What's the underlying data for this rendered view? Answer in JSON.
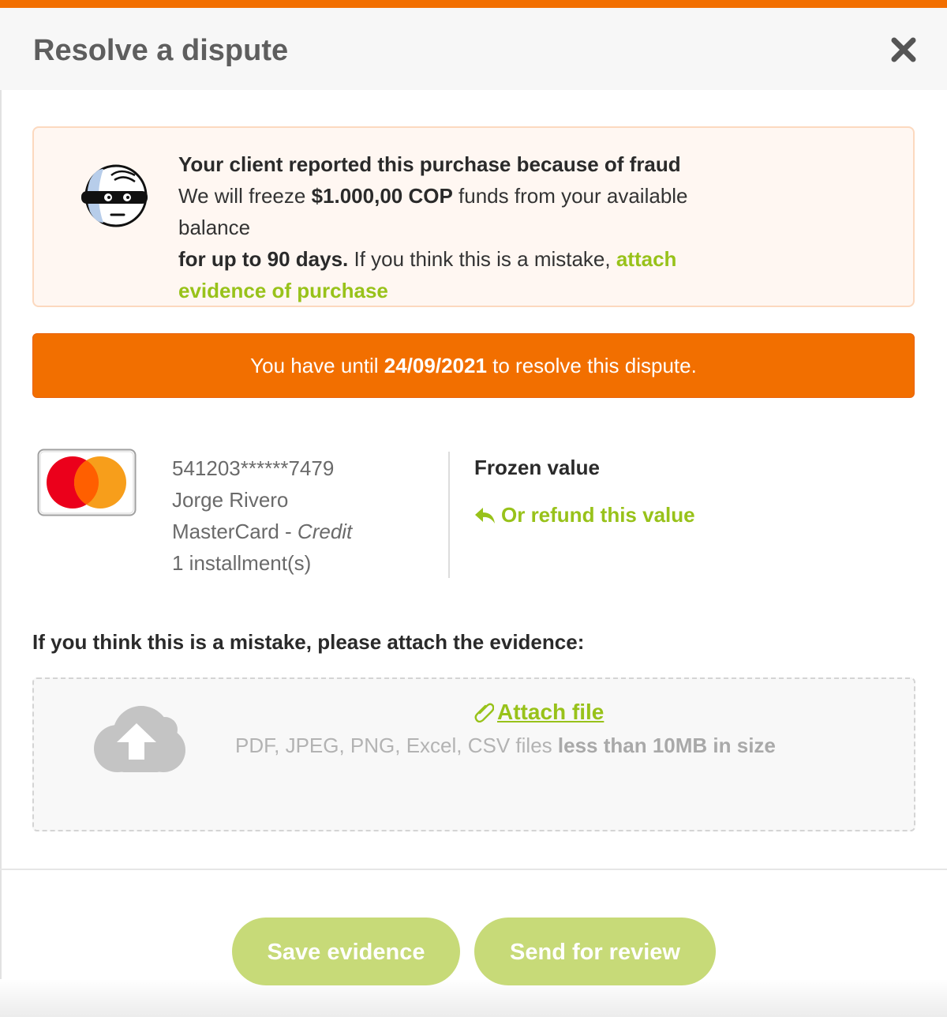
{
  "modal": {
    "title": "Resolve a dispute",
    "close_icon": "close-icon"
  },
  "alert": {
    "icon": "thief-icon",
    "heading": "Your client reported this purchase because of fraud",
    "line1_pre": "We will freeze ",
    "amount": "$1.000,00 COP",
    "line1_post": " funds from your available balance",
    "period": "for up to 90 days.",
    "line2_post": " If you think this is a mistake, ",
    "link": "attach evidence of purchase"
  },
  "deadline": {
    "pre": "You have until ",
    "date": "24/09/2021",
    "post": " to resolve this dispute."
  },
  "card": {
    "brand_icon": "mastercard-icon",
    "number": "541203******7479",
    "holder": "Jorge Rivero",
    "brand": "MasterCard - ",
    "type": "Credit",
    "installments": "1 installment(s)"
  },
  "frozen": {
    "label": "Frozen value",
    "refund_icon": "reply-arrow-icon",
    "refund_link": "Or refund this value"
  },
  "evidence": {
    "label": "If you think this is a mistake, please attach the evidence:",
    "upload_icon": "cloud-upload-icon",
    "attach_icon": "paperclip-icon",
    "attach_link": "Attach file",
    "hint_pre": "PDF, JPEG, PNG, Excel, CSV files ",
    "hint_bold": "less than 10MB in size"
  },
  "actions": {
    "save": "Save evidence",
    "send": "Send for review"
  },
  "colors": {
    "accent_orange": "#f26f00",
    "link_green": "#98c21a",
    "button_green": "#c7da78"
  }
}
